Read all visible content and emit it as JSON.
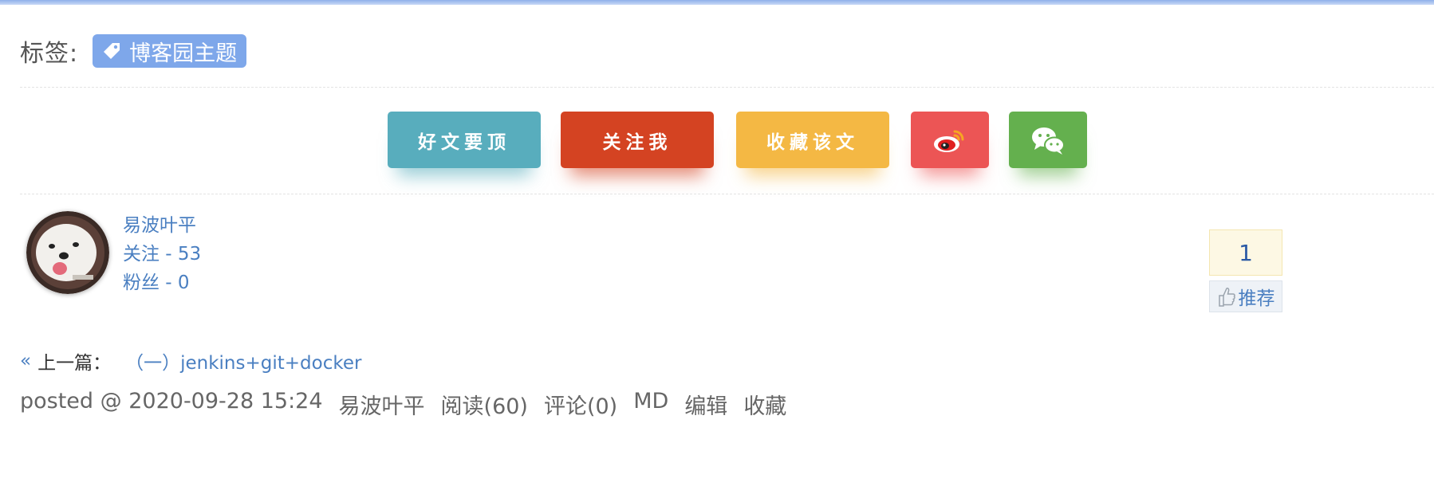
{
  "tags": {
    "label": "标签:",
    "items": [
      "博客园主题"
    ]
  },
  "actions": {
    "digg": "好文要顶",
    "follow": "关注我",
    "favorite": "收藏该文",
    "weibo_icon": "weibo-icon",
    "wechat_icon": "wechat-icon"
  },
  "author": {
    "name": "易波叶平",
    "following": "关注 - 53",
    "followers": "粉丝 - 0"
  },
  "recommend": {
    "count": "1",
    "label": "推荐"
  },
  "prev_post": {
    "arrow": "«",
    "label": "上一篇：",
    "title": "（一）jenkins+git+docker"
  },
  "postfoot": {
    "posted": "posted @ 2020-09-28 15:24",
    "author": "易波叶平",
    "read": "阅读(60)",
    "comment": "评论(0)",
    "md": "MD",
    "edit": "编辑",
    "favorite": "收藏"
  },
  "colors": {
    "accent_link": "#4a7fc1",
    "tag_bg": "#7ea7ea",
    "digg_btn": "#58adbd",
    "follow_btn": "#d44322",
    "fav_btn": "#f4b844",
    "weibo_btn": "#ec5555",
    "wechat_btn": "#64b04e"
  }
}
